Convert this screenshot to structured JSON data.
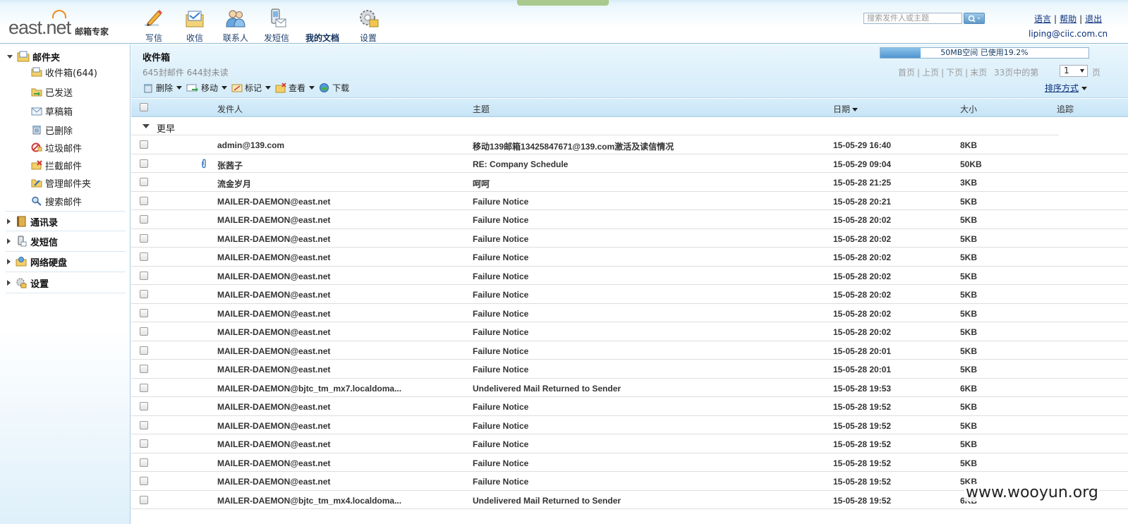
{
  "header": {
    "brand": "east.net",
    "brand_tag": "邮箱专家",
    "nav": [
      {
        "label": "写信",
        "icon": "pencil-icon"
      },
      {
        "label": "收信",
        "icon": "inbox-tray-icon"
      },
      {
        "label": "联系人",
        "icon": "contacts-icon"
      },
      {
        "label": "发短信",
        "icon": "sms-phone-icon"
      },
      {
        "label": "我的文档",
        "icon": ""
      },
      {
        "label": "设置",
        "icon": "gear-icon"
      }
    ],
    "search_placeholder": "搜索发件人或主题",
    "links": {
      "language": "语言",
      "help": "帮助",
      "logout": "退出",
      "sep": "|"
    },
    "user_email": "liping@ciic.com.cn"
  },
  "sidebar": {
    "folders_label": "邮件夹",
    "items": [
      {
        "label": "收件箱(644)",
        "icon": "inbox-folder-icon"
      },
      {
        "label": "已发送",
        "icon": "sent-folder-icon"
      },
      {
        "label": "草稿箱",
        "icon": "draft-envelope-icon"
      },
      {
        "label": "已删除",
        "icon": "trash-icon"
      },
      {
        "label": "垃圾邮件",
        "icon": "spam-icon"
      },
      {
        "label": "拦截邮件",
        "icon": "blocked-mail-icon"
      },
      {
        "label": "管理邮件夹",
        "icon": "manage-folder-icon"
      },
      {
        "label": "搜索邮件",
        "icon": "search-mail-icon"
      }
    ],
    "sections": [
      {
        "label": "通讯录",
        "icon": "address-book-icon"
      },
      {
        "label": "发短信",
        "icon": "sms-icon"
      },
      {
        "label": "网络硬盘",
        "icon": "network-disk-icon"
      },
      {
        "label": "设置",
        "icon": "settings-icon"
      }
    ]
  },
  "mailbox": {
    "title": "收件箱",
    "counts": "645封邮件 644封未读",
    "quota_text": "50MB空间 已使用19.2%",
    "quota_used_pct": 19.2,
    "toolbar": [
      {
        "label": "删除",
        "icon": "trash-icon",
        "dropdown": true
      },
      {
        "label": "移动",
        "icon": "move-mail-icon",
        "dropdown": true
      },
      {
        "label": "标记",
        "icon": "flag-mark-icon",
        "dropdown": true
      },
      {
        "label": "查看",
        "icon": "view-mail-icon",
        "dropdown": true
      },
      {
        "label": "下载",
        "icon": "globe-download-icon",
        "dropdown": false
      }
    ],
    "pager": {
      "first": "首页",
      "prev": "上页",
      "next": "下页",
      "last": "末页",
      "sep": "|",
      "total": "33页中的第",
      "current_page": "1",
      "page_word": "页"
    },
    "sort_label": "排序方式",
    "columns": {
      "from": "发件人",
      "subject": "主题",
      "date": "日期",
      "size": "大小",
      "track": "追踪"
    },
    "group_label": "更早",
    "messages": [
      {
        "from": "admin@139.com",
        "subject": "移动139邮箱13425847671@139.com激活及读信情况",
        "date": "15-05-29 16:40",
        "size": "8KB",
        "attachment": false
      },
      {
        "from": "张茜子",
        "subject": "RE: Company Schedule",
        "date": "15-05-29 09:04",
        "size": "50KB",
        "attachment": true
      },
      {
        "from": "流金岁月",
        "subject": "呵呵",
        "date": "15-05-28 21:25",
        "size": "3KB",
        "attachment": false
      },
      {
        "from": "MAILER-DAEMON@east.net",
        "subject": "Failure Notice",
        "date": "15-05-28 20:21",
        "size": "5KB",
        "attachment": false
      },
      {
        "from": "MAILER-DAEMON@east.net",
        "subject": "Failure Notice",
        "date": "15-05-28 20:02",
        "size": "5KB",
        "attachment": false
      },
      {
        "from": "MAILER-DAEMON@east.net",
        "subject": "Failure Notice",
        "date": "15-05-28 20:02",
        "size": "5KB",
        "attachment": false
      },
      {
        "from": "MAILER-DAEMON@east.net",
        "subject": "Failure Notice",
        "date": "15-05-28 20:02",
        "size": "5KB",
        "attachment": false
      },
      {
        "from": "MAILER-DAEMON@east.net",
        "subject": "Failure Notice",
        "date": "15-05-28 20:02",
        "size": "5KB",
        "attachment": false
      },
      {
        "from": "MAILER-DAEMON@east.net",
        "subject": "Failure Notice",
        "date": "15-05-28 20:02",
        "size": "5KB",
        "attachment": false
      },
      {
        "from": "MAILER-DAEMON@east.net",
        "subject": "Failure Notice",
        "date": "15-05-28 20:02",
        "size": "5KB",
        "attachment": false
      },
      {
        "from": "MAILER-DAEMON@east.net",
        "subject": "Failure Notice",
        "date": "15-05-28 20:02",
        "size": "5KB",
        "attachment": false
      },
      {
        "from": "MAILER-DAEMON@east.net",
        "subject": "Failure Notice",
        "date": "15-05-28 20:01",
        "size": "5KB",
        "attachment": false
      },
      {
        "from": "MAILER-DAEMON@east.net",
        "subject": "Failure Notice",
        "date": "15-05-28 20:01",
        "size": "5KB",
        "attachment": false
      },
      {
        "from": "MAILER-DAEMON@bjtc_tm_mx7.localdoma...",
        "subject": "Undelivered Mail Returned to Sender",
        "date": "15-05-28 19:53",
        "size": "6KB",
        "attachment": false
      },
      {
        "from": "MAILER-DAEMON@east.net",
        "subject": "Failure Notice",
        "date": "15-05-28 19:52",
        "size": "5KB",
        "attachment": false
      },
      {
        "from": "MAILER-DAEMON@east.net",
        "subject": "Failure Notice",
        "date": "15-05-28 19:52",
        "size": "5KB",
        "attachment": false
      },
      {
        "from": "MAILER-DAEMON@east.net",
        "subject": "Failure Notice",
        "date": "15-05-28 19:52",
        "size": "5KB",
        "attachment": false
      },
      {
        "from": "MAILER-DAEMON@east.net",
        "subject": "Failure Notice",
        "date": "15-05-28 19:52",
        "size": "5KB",
        "attachment": false
      },
      {
        "from": "MAILER-DAEMON@east.net",
        "subject": "Failure Notice",
        "date": "15-05-28 19:52",
        "size": "5KB",
        "attachment": false
      },
      {
        "from": "MAILER-DAEMON@bjtc_tm_mx4.localdoma...",
        "subject": "Undelivered Mail Returned to Sender",
        "date": "15-05-28 19:52",
        "size": "6KB",
        "attachment": false
      }
    ]
  },
  "watermark": "www.wooyun.org",
  "colors": {
    "link": "#0b2f7a",
    "header_bg": "#d6ecf8",
    "quota_fill": "#4f95d0",
    "logo_cloud": "#f08a1c"
  }
}
